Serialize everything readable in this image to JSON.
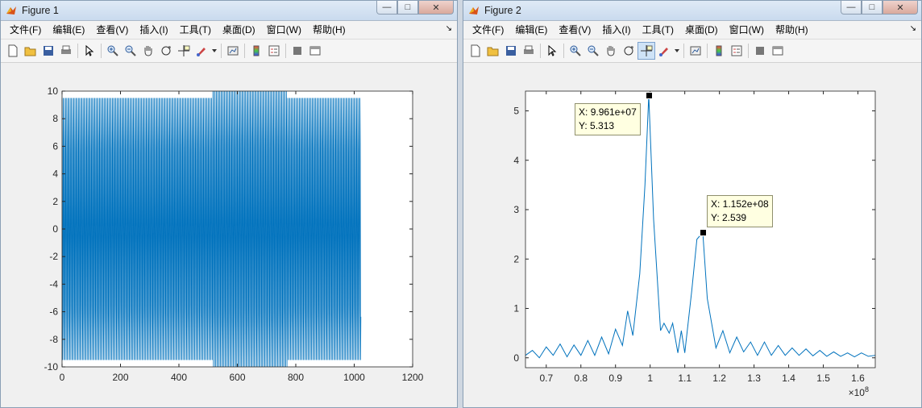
{
  "menus": [
    "文件(F)",
    "编辑(E)",
    "查看(V)",
    "插入(I)",
    "工具(T)",
    "桌面(D)",
    "窗口(W)",
    "帮助(H)"
  ],
  "toolbar_icons": [
    "new-icon",
    "open-icon",
    "save-icon",
    "print-icon",
    "pointer-icon",
    "zoom-in-icon",
    "zoom-out-icon",
    "pan-icon",
    "rotate-icon",
    "data-cursor-icon",
    "brush-icon",
    "brush-dropdown-icon",
    "link-plot-icon",
    "colorbar-icon",
    "legend-icon",
    "hide-tools-icon",
    "show-tools-icon"
  ],
  "window_buttons": {
    "minimize": "—",
    "maximize": "□",
    "close": "✕"
  },
  "fig1": {
    "title": "Figure 1",
    "chart_data": {
      "type": "line",
      "color": "#0072bd",
      "xlim": [
        0,
        1200
      ],
      "ylim": [
        -10,
        10
      ],
      "xticks": [
        "0",
        "200",
        "400",
        "600",
        "800",
        "1000",
        "1200"
      ],
      "yticks": [
        "10",
        "8",
        "6",
        "4",
        "2",
        "0",
        "-2",
        "-4",
        "-6",
        "-8",
        "-10"
      ],
      "n_samples": 1024,
      "amplitude_base": 9.5,
      "amplitude_peak": 10,
      "high_amplitude_range": [
        515,
        770
      ]
    }
  },
  "fig2": {
    "title": "Figure 2",
    "chart_data": {
      "type": "line",
      "color": "#0072bd",
      "xlim": [
        0.64,
        1.65
      ],
      "ylim": [
        -0.2,
        5.4
      ],
      "xticks": [
        "0.7",
        "0.8",
        "0.9",
        "1",
        "1.1",
        "1.2",
        "1.3",
        "1.4",
        "1.5",
        "1.6"
      ],
      "yticks": [
        "5",
        "4",
        "3",
        "2",
        "1",
        "0"
      ],
      "x_exponent": "×10^8",
      "x": [
        0.64,
        0.66,
        0.68,
        0.7,
        0.72,
        0.74,
        0.76,
        0.78,
        0.8,
        0.82,
        0.84,
        0.86,
        0.88,
        0.9,
        0.92,
        0.935,
        0.95,
        0.97,
        0.985,
        0.996,
        1.01,
        1.03,
        1.04,
        1.055,
        1.065,
        1.08,
        1.09,
        1.1,
        1.12,
        1.135,
        1.152,
        1.165,
        1.19,
        1.21,
        1.23,
        1.25,
        1.27,
        1.29,
        1.31,
        1.33,
        1.35,
        1.37,
        1.39,
        1.41,
        1.43,
        1.45,
        1.47,
        1.49,
        1.51,
        1.53,
        1.55,
        1.57,
        1.59,
        1.61,
        1.63,
        1.65
      ],
      "y": [
        0.05,
        0.15,
        0.0,
        0.22,
        0.05,
        0.28,
        0.02,
        0.26,
        0.05,
        0.35,
        0.05,
        0.42,
        0.08,
        0.58,
        0.25,
        0.95,
        0.45,
        1.7,
        3.5,
        5.313,
        2.8,
        0.55,
        0.7,
        0.5,
        0.7,
        0.1,
        0.55,
        0.1,
        1.35,
        2.4,
        2.539,
        1.2,
        0.2,
        0.55,
        0.1,
        0.42,
        0.12,
        0.32,
        0.05,
        0.32,
        0.05,
        0.25,
        0.05,
        0.2,
        0.05,
        0.18,
        0.04,
        0.15,
        0.03,
        0.12,
        0.03,
        0.1,
        0.02,
        0.1,
        0.03,
        0.05
      ],
      "datatips": [
        {
          "x_label": "X: 9.961e+07",
          "y_label": "Y: 5.313",
          "x": 0.9961,
          "y": 5.313
        },
        {
          "x_label": "X: 1.152e+08",
          "y_label": "Y: 2.539",
          "x": 1.152,
          "y": 2.539
        }
      ]
    }
  }
}
